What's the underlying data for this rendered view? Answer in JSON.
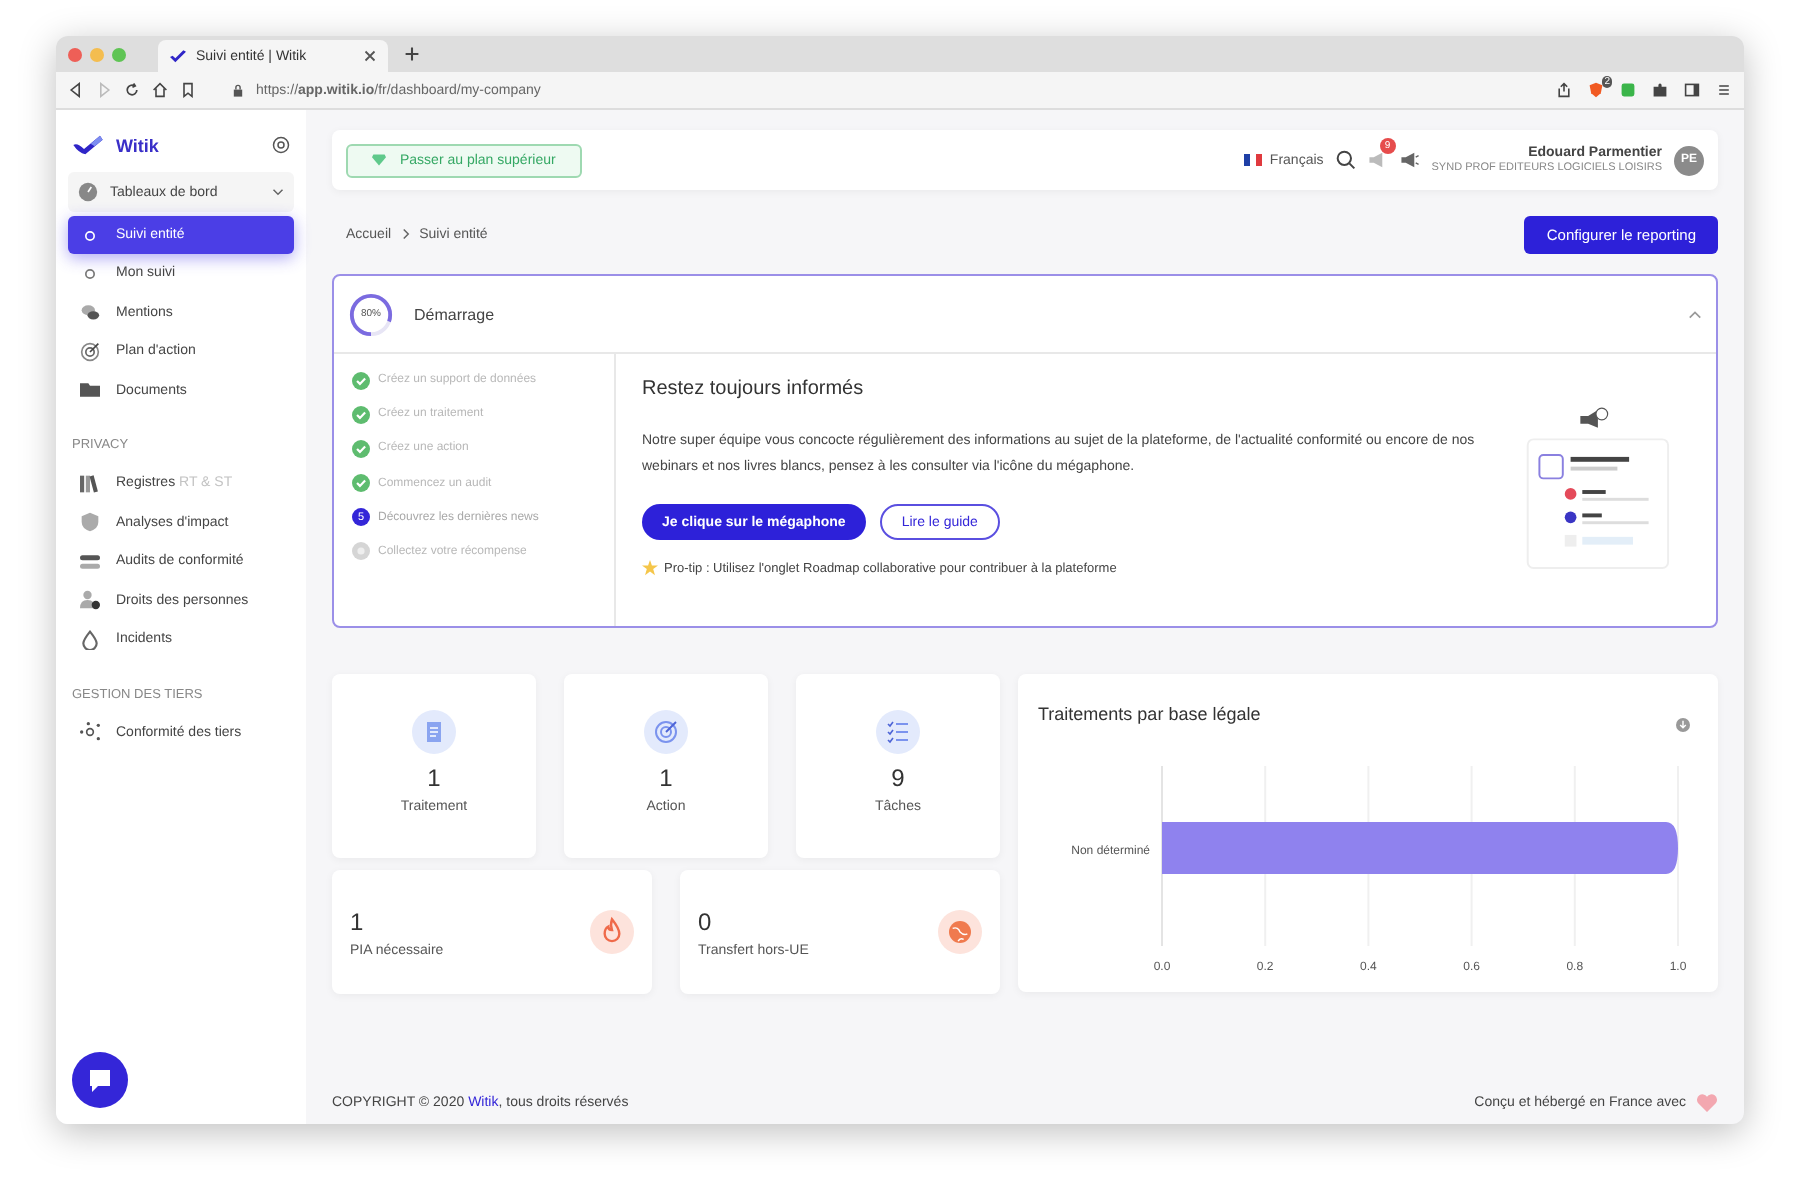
{
  "browser": {
    "tab_title": "Suivi entité | Witik",
    "url": "https://**app.witik.io**/fr/dashboard/my-company",
    "extension_badge": "2"
  },
  "sidebar": {
    "brand": "Witik",
    "menu": "Tableaux de bord",
    "items": [
      {
        "kind": "link",
        "label": "Suivi entité",
        "selected": true
      },
      {
        "kind": "link",
        "label": "Mon suivi",
        "selected": false
      },
      {
        "kind": "link",
        "label": "Mentions",
        "selected": false
      },
      {
        "kind": "link",
        "label": "Plan d'action",
        "selected": false
      },
      {
        "kind": "link",
        "label": "Documents",
        "selected": false
      },
      {
        "kind": "heading",
        "label": "PRIVACY"
      },
      {
        "kind": "link",
        "label": "Registres",
        "suffix": "RT & ST",
        "selected": false
      },
      {
        "kind": "link",
        "label": "Analyses d'impact",
        "selected": false
      },
      {
        "kind": "link",
        "label": "Audits de conformité",
        "selected": false
      },
      {
        "kind": "link",
        "label": "Droits des personnes",
        "selected": false
      },
      {
        "kind": "link",
        "label": "Incidents",
        "selected": false
      },
      {
        "kind": "heading",
        "label": "GESTION DES TIERS"
      },
      {
        "kind": "link",
        "label": "Conformité des tiers",
        "selected": false
      }
    ]
  },
  "header": {
    "upgrade_button": "Passer au plan supérieur",
    "language": "Français",
    "notification_count": "9",
    "user_name": "Edouard Parmentier",
    "user_org": "SYND PROF EDITEURS LOGICIELS LOISIRS",
    "avatar": "PE"
  },
  "breadcrumb": [
    "Accueil",
    "Suivi entité"
  ],
  "config_button": "Configurer le reporting",
  "onboarding": {
    "progress_label": "80%",
    "level": 0.8,
    "title": "Démarrage",
    "expanded": true,
    "steps": [
      {
        "label": "Créez un support de données",
        "completed": true,
        "current": false
      },
      {
        "label": "Créez un traitement",
        "completed": true,
        "current": false
      },
      {
        "label": "Créez une action",
        "completed": true,
        "current": false
      },
      {
        "label": "Commencez un audit",
        "completed": true,
        "current": false
      },
      {
        "label": "Découvrez les dernières news",
        "completed": false,
        "current": true,
        "number": "5"
      },
      {
        "label": "Collectez votre récompense",
        "completed": false,
        "current": false
      }
    ],
    "news_title": "Restez toujours informés",
    "news_text": "Notre super équipe vous concocte régulièrement des informations au sujet de la plateforme, de l'actualité conformité ou encore de nos webinars et nos livres blancs, pensez à les consulter via l'icône du mégaphone.",
    "primary_button": "Je clique sur le mégaphone",
    "secondary_button": "Lire le guide",
    "tip": "Pro-tip : Utilisez l'onglet Roadmap collaborative pour contribuer à la plateforme"
  },
  "stats": [
    {
      "value": "1",
      "label": "Traitement"
    },
    {
      "value": "1",
      "label": "Action"
    },
    {
      "value": "9",
      "label": "Tâches"
    }
  ],
  "stats_wide": [
    {
      "value": "1",
      "label": "PIA nécessaire"
    },
    {
      "value": "0",
      "label": "Transfert hors-UE"
    }
  ],
  "chart": {
    "title": "Traitements par base légale",
    "chart_data": {
      "type": "bar",
      "orientation": "horizontal",
      "categories": [
        "Non déterminé"
      ],
      "values": [
        1
      ],
      "xlim": [
        0,
        1
      ],
      "grid": true,
      "xticks": [
        {
          "value": 0,
          "label": "0.0"
        },
        {
          "value": 0.2,
          "label": "0.2"
        },
        {
          "value": 0.4,
          "label": "0.4"
        },
        {
          "value": 0.6,
          "label": "0.6"
        },
        {
          "value": 0.8,
          "label": "0.8"
        },
        {
          "value": 1,
          "label": "1.0"
        }
      ]
    }
  },
  "footer": {
    "copyright": "COPYRIGHT © 2020 ",
    "copyright_link": "Witik",
    "copyright_end": ", tous droits réservés",
    "made_in": "Conçu et hébergé en France avec"
  }
}
